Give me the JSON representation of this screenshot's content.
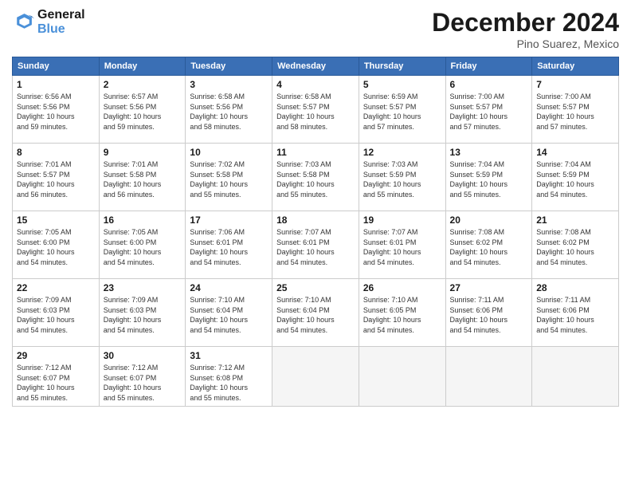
{
  "logo": {
    "line1": "General",
    "line2": "Blue"
  },
  "title": "December 2024",
  "location": "Pino Suarez, Mexico",
  "days_header": [
    "Sunday",
    "Monday",
    "Tuesday",
    "Wednesday",
    "Thursday",
    "Friday",
    "Saturday"
  ],
  "weeks": [
    [
      {
        "day": "1",
        "info": "Sunrise: 6:56 AM\nSunset: 5:56 PM\nDaylight: 10 hours\nand 59 minutes."
      },
      {
        "day": "2",
        "info": "Sunrise: 6:57 AM\nSunset: 5:56 PM\nDaylight: 10 hours\nand 59 minutes."
      },
      {
        "day": "3",
        "info": "Sunrise: 6:58 AM\nSunset: 5:56 PM\nDaylight: 10 hours\nand 58 minutes."
      },
      {
        "day": "4",
        "info": "Sunrise: 6:58 AM\nSunset: 5:57 PM\nDaylight: 10 hours\nand 58 minutes."
      },
      {
        "day": "5",
        "info": "Sunrise: 6:59 AM\nSunset: 5:57 PM\nDaylight: 10 hours\nand 57 minutes."
      },
      {
        "day": "6",
        "info": "Sunrise: 7:00 AM\nSunset: 5:57 PM\nDaylight: 10 hours\nand 57 minutes."
      },
      {
        "day": "7",
        "info": "Sunrise: 7:00 AM\nSunset: 5:57 PM\nDaylight: 10 hours\nand 57 minutes."
      }
    ],
    [
      {
        "day": "8",
        "info": "Sunrise: 7:01 AM\nSunset: 5:57 PM\nDaylight: 10 hours\nand 56 minutes."
      },
      {
        "day": "9",
        "info": "Sunrise: 7:01 AM\nSunset: 5:58 PM\nDaylight: 10 hours\nand 56 minutes."
      },
      {
        "day": "10",
        "info": "Sunrise: 7:02 AM\nSunset: 5:58 PM\nDaylight: 10 hours\nand 55 minutes."
      },
      {
        "day": "11",
        "info": "Sunrise: 7:03 AM\nSunset: 5:58 PM\nDaylight: 10 hours\nand 55 minutes."
      },
      {
        "day": "12",
        "info": "Sunrise: 7:03 AM\nSunset: 5:59 PM\nDaylight: 10 hours\nand 55 minutes."
      },
      {
        "day": "13",
        "info": "Sunrise: 7:04 AM\nSunset: 5:59 PM\nDaylight: 10 hours\nand 55 minutes."
      },
      {
        "day": "14",
        "info": "Sunrise: 7:04 AM\nSunset: 5:59 PM\nDaylight: 10 hours\nand 54 minutes."
      }
    ],
    [
      {
        "day": "15",
        "info": "Sunrise: 7:05 AM\nSunset: 6:00 PM\nDaylight: 10 hours\nand 54 minutes."
      },
      {
        "day": "16",
        "info": "Sunrise: 7:05 AM\nSunset: 6:00 PM\nDaylight: 10 hours\nand 54 minutes."
      },
      {
        "day": "17",
        "info": "Sunrise: 7:06 AM\nSunset: 6:01 PM\nDaylight: 10 hours\nand 54 minutes."
      },
      {
        "day": "18",
        "info": "Sunrise: 7:07 AM\nSunset: 6:01 PM\nDaylight: 10 hours\nand 54 minutes."
      },
      {
        "day": "19",
        "info": "Sunrise: 7:07 AM\nSunset: 6:01 PM\nDaylight: 10 hours\nand 54 minutes."
      },
      {
        "day": "20",
        "info": "Sunrise: 7:08 AM\nSunset: 6:02 PM\nDaylight: 10 hours\nand 54 minutes."
      },
      {
        "day": "21",
        "info": "Sunrise: 7:08 AM\nSunset: 6:02 PM\nDaylight: 10 hours\nand 54 minutes."
      }
    ],
    [
      {
        "day": "22",
        "info": "Sunrise: 7:09 AM\nSunset: 6:03 PM\nDaylight: 10 hours\nand 54 minutes."
      },
      {
        "day": "23",
        "info": "Sunrise: 7:09 AM\nSunset: 6:03 PM\nDaylight: 10 hours\nand 54 minutes."
      },
      {
        "day": "24",
        "info": "Sunrise: 7:10 AM\nSunset: 6:04 PM\nDaylight: 10 hours\nand 54 minutes."
      },
      {
        "day": "25",
        "info": "Sunrise: 7:10 AM\nSunset: 6:04 PM\nDaylight: 10 hours\nand 54 minutes."
      },
      {
        "day": "26",
        "info": "Sunrise: 7:10 AM\nSunset: 6:05 PM\nDaylight: 10 hours\nand 54 minutes."
      },
      {
        "day": "27",
        "info": "Sunrise: 7:11 AM\nSunset: 6:06 PM\nDaylight: 10 hours\nand 54 minutes."
      },
      {
        "day": "28",
        "info": "Sunrise: 7:11 AM\nSunset: 6:06 PM\nDaylight: 10 hours\nand 54 minutes."
      }
    ],
    [
      {
        "day": "29",
        "info": "Sunrise: 7:12 AM\nSunset: 6:07 PM\nDaylight: 10 hours\nand 55 minutes."
      },
      {
        "day": "30",
        "info": "Sunrise: 7:12 AM\nSunset: 6:07 PM\nDaylight: 10 hours\nand 55 minutes."
      },
      {
        "day": "31",
        "info": "Sunrise: 7:12 AM\nSunset: 6:08 PM\nDaylight: 10 hours\nand 55 minutes."
      },
      {
        "day": "",
        "info": ""
      },
      {
        "day": "",
        "info": ""
      },
      {
        "day": "",
        "info": ""
      },
      {
        "day": "",
        "info": ""
      }
    ]
  ]
}
